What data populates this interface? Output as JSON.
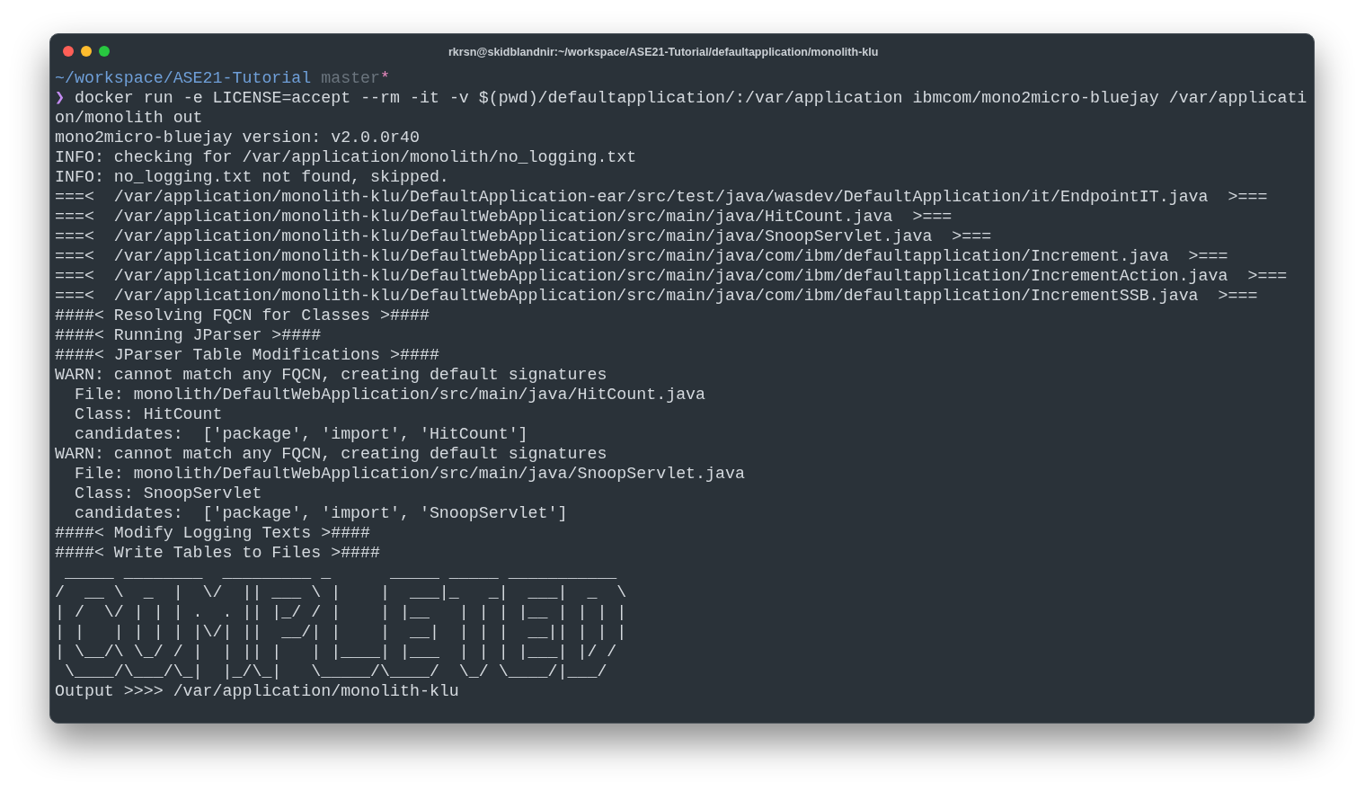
{
  "window": {
    "title": "rkrsn@skidblandnir:~/workspace/ASE21-Tutorial/defaultapplication/monolith-klu"
  },
  "prompt": {
    "path": "~/workspace/ASE21-Tutorial",
    "branch": "master",
    "dirty_mark": "*",
    "symbol": "❯",
    "command": "docker run -e LICENSE=accept --rm -it -v $(pwd)/defaultapplication/:/var/application ibmcom/mono2micro-bluejay /var/applicati"
  },
  "lines": [
    "on/monolith out",
    "mono2micro-bluejay version: v2.0.0r40",
    "INFO: checking for /var/application/monolith/no_logging.txt",
    "INFO: no_logging.txt not found, skipped.",
    "===<  /var/application/monolith-klu/DefaultApplication-ear/src/test/java/wasdev/DefaultApplication/it/EndpointIT.java  >===",
    "===<  /var/application/monolith-klu/DefaultWebApplication/src/main/java/HitCount.java  >===",
    "===<  /var/application/monolith-klu/DefaultWebApplication/src/main/java/SnoopServlet.java  >===",
    "===<  /var/application/monolith-klu/DefaultWebApplication/src/main/java/com/ibm/defaultapplication/Increment.java  >===",
    "===<  /var/application/monolith-klu/DefaultWebApplication/src/main/java/com/ibm/defaultapplication/IncrementAction.java  >===",
    "===<  /var/application/monolith-klu/DefaultWebApplication/src/main/java/com/ibm/defaultapplication/IncrementSSB.java  >===",
    "####< Resolving FQCN for Classes >####",
    "####< Running JParser >####",
    "####< JParser Table Modifications >####",
    "WARN: cannot match any FQCN, creating default signatures",
    "  File: monolith/DefaultWebApplication/src/main/java/HitCount.java",
    "  Class: HitCount",
    "  candidates:  ['package', 'import', 'HitCount']",
    "WARN: cannot match any FQCN, creating default signatures",
    "  File: monolith/DefaultWebApplication/src/main/java/SnoopServlet.java",
    "  Class: SnoopServlet",
    "  candidates:  ['package', 'import', 'SnoopServlet']",
    "####< Modify Logging Texts >####",
    "####< Write Tables to Files >####"
  ],
  "ascii_art": [
    " _____ ________  _________ _      _____ _____ ___________",
    "/  __ \\  _  |  \\/  || ___ \\ |    |  ___|_   _|  ___|  _  \\",
    "| /  \\/ | | | .  . || |_/ / |    | |__   | | | |__ | | | |",
    "| |   | | | | |\\/| ||  __/| |    |  __|  | | |  __|| | | |",
    "| \\__/\\ \\_/ / |  | || |   | |____| |___  | | | |___| |/ /",
    " \\____/\\___/\\_|  |_/\\_|   \\_____/\\____/  \\_/ \\____/|___/"
  ],
  "final_line": "Output >>>> /var/application/monolith-klu"
}
